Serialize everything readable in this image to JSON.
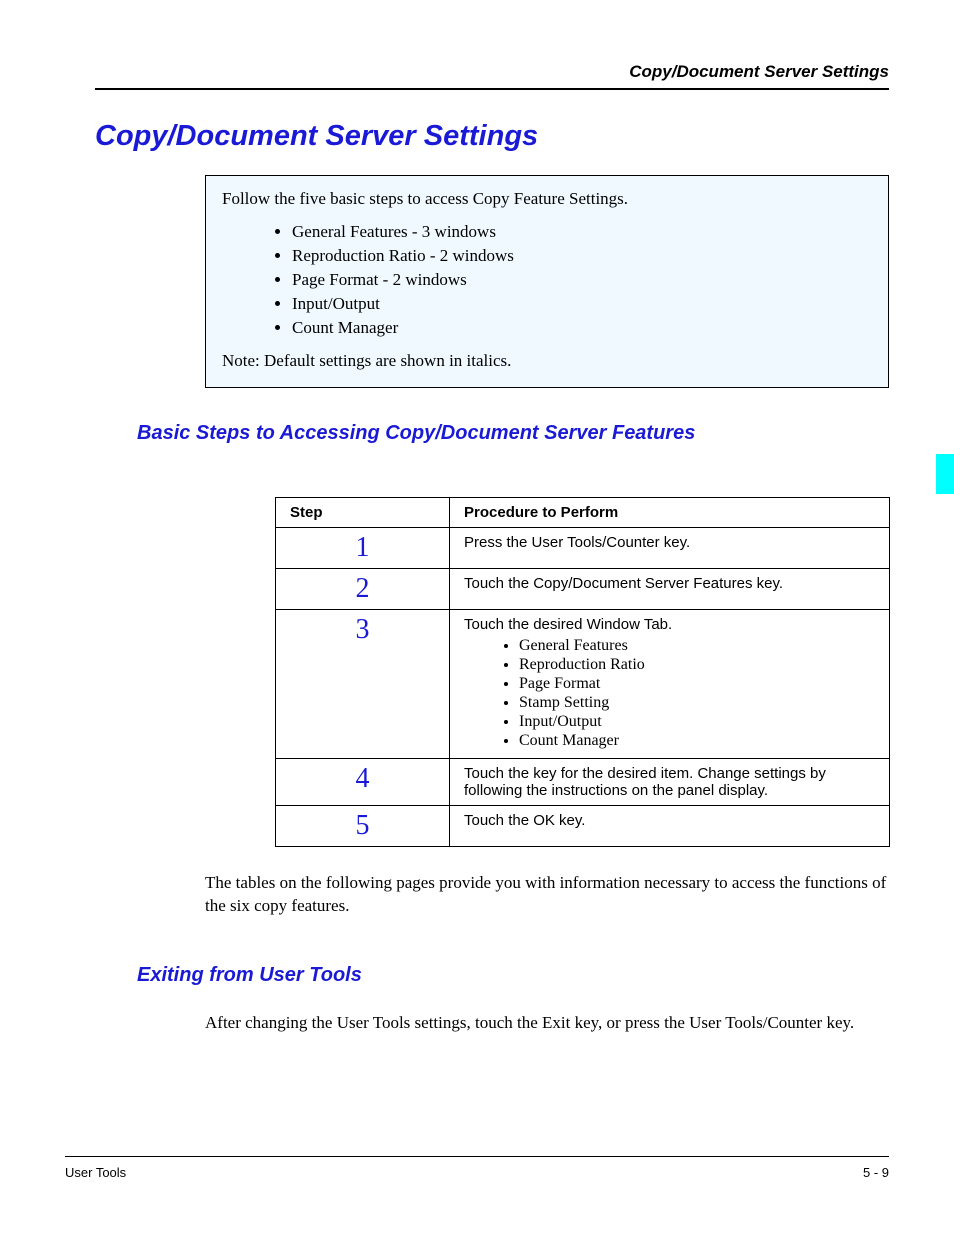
{
  "header": {
    "running_title": "Copy/Document Server Settings"
  },
  "title": "Copy/Document Server Settings",
  "callout": {
    "intro": "Follow the five basic steps to access Copy Feature Settings.",
    "items": [
      "General Features - 3 windows",
      "Reproduction Ratio - 2 windows",
      "Page Format - 2 windows",
      "Input/Output",
      "Count Manager"
    ],
    "note": "Note: Default settings are shown in italics."
  },
  "section1": {
    "heading": "Basic Steps to Accessing Copy/Document Server Features",
    "table": {
      "col1": "Step",
      "col2": "Procedure to Perform",
      "rows": [
        {
          "num": "1",
          "text": "Press the User Tools/Counter key."
        },
        {
          "num": "2",
          "text": "Touch the Copy/Document Server Features key."
        },
        {
          "num": "3",
          "text": "Touch the desired Window Tab.",
          "list": [
            "General Features",
            "Reproduction Ratio",
            "Page Format",
            "Stamp Setting",
            "Input/Output",
            "Count Manager"
          ]
        },
        {
          "num": "4",
          "text": "Touch the key for the desired item. Change settings by following the instructions on the panel display."
        },
        {
          "num": "5",
          "text": "Touch the OK key."
        }
      ]
    },
    "followup": "The tables on the following pages provide you with information necessary to access the functions of the six copy features."
  },
  "section2": {
    "heading": "Exiting from User Tools",
    "body": "After changing the User Tools settings, touch the Exit key, or press the User Tools/Counter key."
  },
  "footer": {
    "left": "User Tools",
    "right": "5 - 9"
  }
}
